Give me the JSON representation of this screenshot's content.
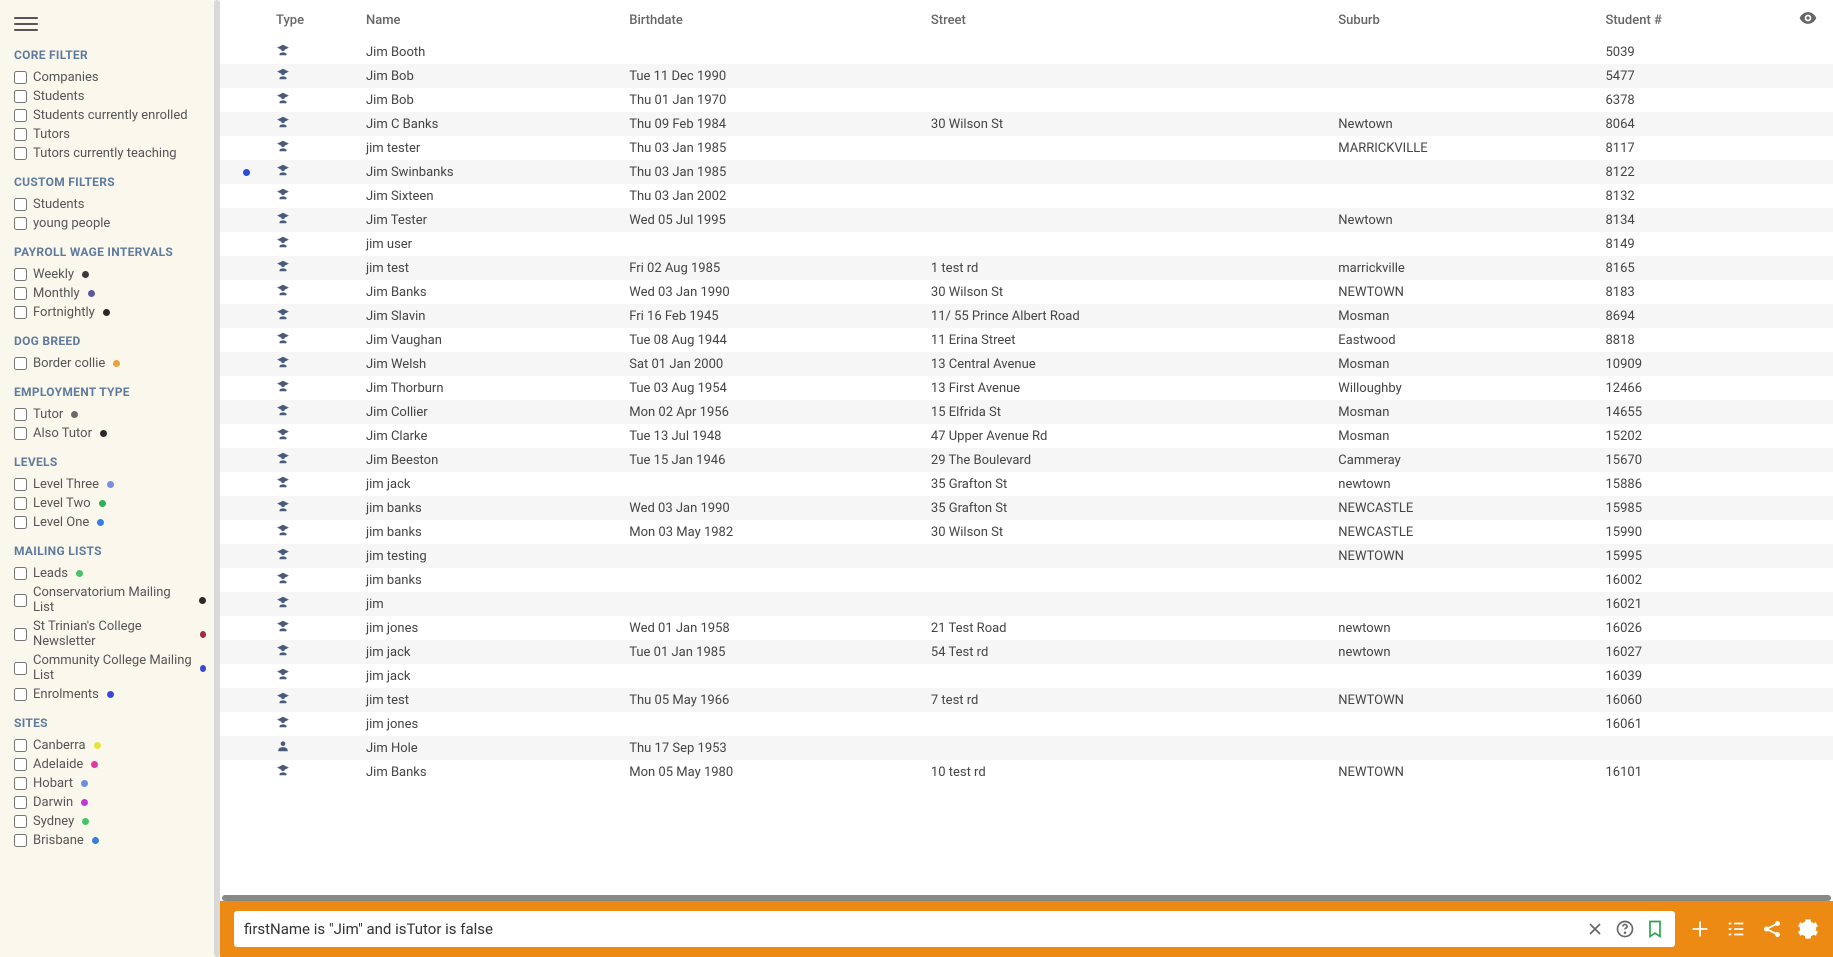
{
  "sidebar": [
    {
      "title": "CORE FILTER",
      "items": [
        {
          "label": "Companies"
        },
        {
          "label": "Students"
        },
        {
          "label": "Students currently enrolled"
        },
        {
          "label": "Tutors"
        },
        {
          "label": "Tutors currently teaching"
        }
      ]
    },
    {
      "title": "CUSTOM FILTERS",
      "items": [
        {
          "label": "Students"
        },
        {
          "label": "young people"
        }
      ]
    },
    {
      "title": "PAYROLL WAGE INTERVALS",
      "items": [
        {
          "label": "Weekly",
          "dot": "#3a3a3a"
        },
        {
          "label": "Monthly",
          "dot": "#5a5a9a"
        },
        {
          "label": "Fortnightly",
          "dot": "#2a2a2a"
        }
      ]
    },
    {
      "title": "DOG BREED",
      "items": [
        {
          "label": "Border collie",
          "dot": "#e8a23d"
        }
      ]
    },
    {
      "title": "EMPLOYMENT TYPE",
      "items": [
        {
          "label": "Tutor",
          "dot": "#6a6a6a"
        },
        {
          "label": "Also Tutor",
          "dot": "#2a2a2a"
        }
      ]
    },
    {
      "title": "LEVELS",
      "items": [
        {
          "label": "Level Three",
          "dot": "#7a8de0"
        },
        {
          "label": "Level Two",
          "dot": "#2bb05a"
        },
        {
          "label": "Level One",
          "dot": "#3a7de0"
        }
      ]
    },
    {
      "title": "MAILING LISTS",
      "items": [
        {
          "label": "Leads",
          "dot": "#4ac26b"
        },
        {
          "label": "Conservatorium Mailing List",
          "dot": "#2a2a2a"
        },
        {
          "label": "St Trinian's College Newsletter",
          "dot": "#a02a4a"
        },
        {
          "label": "Community College Mailing List",
          "dot": "#3a4ad0"
        },
        {
          "label": "Enrolments",
          "dot": "#3a4ad0"
        }
      ]
    },
    {
      "title": "SITES",
      "items": [
        {
          "label": "Canberra",
          "dot": "#e8e23d"
        },
        {
          "label": "Adelaide",
          "dot": "#e03aa0"
        },
        {
          "label": "Hobart",
          "dot": "#6a8de0"
        },
        {
          "label": "Darwin",
          "dot": "#c03ad0"
        },
        {
          "label": "Sydney",
          "dot": "#4ac26b"
        },
        {
          "label": "Brisbane",
          "dot": "#3a7de0"
        }
      ]
    }
  ],
  "columns": [
    "Type",
    "Name",
    "Birthdate",
    "Street",
    "Suburb",
    "Student #"
  ],
  "rows": [
    {
      "name": "Jim Booth",
      "birth": "",
      "street": "",
      "suburb": "",
      "num": "5039"
    },
    {
      "name": "Jim Bob",
      "birth": "Tue 11 Dec 1990",
      "street": "",
      "suburb": "",
      "num": "5477"
    },
    {
      "name": "Jim Bob",
      "birth": "Thu 01 Jan 1970",
      "street": "",
      "suburb": "",
      "num": "6378"
    },
    {
      "name": "Jim C Banks",
      "birth": "Thu 09 Feb 1984",
      "street": "30 Wilson St",
      "suburb": "Newtown",
      "num": "8064"
    },
    {
      "name": "jim tester",
      "birth": "Thu 03 Jan 1985",
      "street": "",
      "suburb": "MARRICKVILLE",
      "num": "8117"
    },
    {
      "name": "Jim Swinbanks",
      "birth": "Thu 03 Jan 1985",
      "street": "",
      "suburb": "",
      "num": "8122",
      "dot": "#2a4ad0"
    },
    {
      "name": "Jim Sixteen",
      "birth": "Thu 03 Jan 2002",
      "street": "",
      "suburb": "",
      "num": "8132"
    },
    {
      "name": "Jim Tester",
      "birth": "Wed 05 Jul 1995",
      "street": "",
      "suburb": "Newtown",
      "num": "8134"
    },
    {
      "name": "jim user",
      "birth": "",
      "street": "",
      "suburb": "",
      "num": "8149"
    },
    {
      "name": "jim test",
      "birth": "Fri 02 Aug 1985",
      "street": "1 test rd",
      "suburb": "marrickville",
      "num": "8165"
    },
    {
      "name": "Jim Banks",
      "birth": "Wed 03 Jan 1990",
      "street": "30 Wilson St",
      "suburb": "NEWTOWN",
      "num": "8183"
    },
    {
      "name": "Jim Slavin",
      "birth": "Fri 16 Feb 1945",
      "street": "11/ 55 Prince Albert Road",
      "suburb": "Mosman",
      "num": "8694"
    },
    {
      "name": "Jim Vaughan",
      "birth": "Tue 08 Aug 1944",
      "street": "11 Erina Street",
      "suburb": "Eastwood",
      "num": "8818"
    },
    {
      "name": "Jim Welsh",
      "birth": "Sat 01 Jan 2000",
      "street": "13 Central Avenue",
      "suburb": "Mosman",
      "num": "10909"
    },
    {
      "name": "Jim Thorburn",
      "birth": "Tue 03 Aug 1954",
      "street": "13 First Avenue",
      "suburb": "Willoughby",
      "num": "12466"
    },
    {
      "name": "Jim Collier",
      "birth": "Mon 02 Apr 1956",
      "street": "15 Elfrida St",
      "suburb": "Mosman",
      "num": "14655"
    },
    {
      "name": "Jim Clarke",
      "birth": "Tue 13 Jul 1948",
      "street": "47 Upper Avenue Rd",
      "suburb": "Mosman",
      "num": "15202"
    },
    {
      "name": "Jim Beeston",
      "birth": "Tue 15 Jan 1946",
      "street": "29 The Boulevard",
      "suburb": "Cammeray",
      "num": "15670"
    },
    {
      "name": "jim jack",
      "birth": "",
      "street": "35 Grafton St",
      "suburb": "newtown",
      "num": "15886"
    },
    {
      "name": "jim banks",
      "birth": "Wed 03 Jan 1990",
      "street": "35 Grafton St",
      "suburb": "NEWCASTLE",
      "num": "15985"
    },
    {
      "name": "jim banks",
      "birth": "Mon 03 May 1982",
      "street": "30 Wilson St",
      "suburb": "NEWCASTLE",
      "num": "15990"
    },
    {
      "name": "jim testing",
      "birth": "",
      "street": "",
      "suburb": "NEWTOWN",
      "num": "15995"
    },
    {
      "name": "jim banks",
      "birth": "",
      "street": "",
      "suburb": "",
      "num": "16002"
    },
    {
      "name": "jim",
      "birth": "",
      "street": "",
      "suburb": "",
      "num": "16021"
    },
    {
      "name": "jim jones",
      "birth": "Wed 01 Jan 1958",
      "street": "21 Test Road",
      "suburb": "newtown",
      "num": "16026"
    },
    {
      "name": "jim jack",
      "birth": "Tue 01 Jan 1985",
      "street": "54 Test rd",
      "suburb": "newtown",
      "num": "16027"
    },
    {
      "name": "jim jack",
      "birth": "",
      "street": "",
      "suburb": "",
      "num": "16039"
    },
    {
      "name": "jim test",
      "birth": "Thu 05 May 1966",
      "street": "7 test rd",
      "suburb": "NEWTOWN",
      "num": "16060"
    },
    {
      "name": "jim jones",
      "birth": "",
      "street": "",
      "suburb": "",
      "num": "16061"
    },
    {
      "name": "Jim Hole",
      "birth": "Thu 17 Sep 1953",
      "street": "",
      "suburb": "",
      "num": "",
      "alt_icon": true
    },
    {
      "name": "Jim Banks",
      "birth": "Mon 05 May 1980",
      "street": "10 test rd",
      "suburb": "NEWTOWN",
      "num": "16101"
    }
  ],
  "search": {
    "value": "firstName is \"Jim\" and isTutor is false"
  }
}
